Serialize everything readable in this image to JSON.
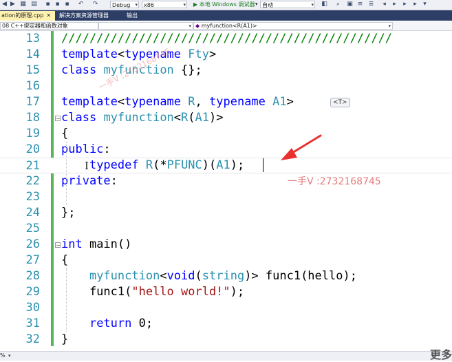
{
  "toolbar": {
    "config": "Debug",
    "platform": "x86",
    "run_label": "▶ 本地 Windows 调试器",
    "run_mode": "自动"
  },
  "tabs": [
    {
      "label": "ation的原理.cpp",
      "active": true
    },
    {
      "label": "解决方案资源管理器",
      "active": false
    },
    {
      "label": "输出",
      "active": false
    }
  ],
  "nav": {
    "project": "08 C++绑定器和函数对象",
    "scope": "",
    "member": "myfunction<R(A1)>"
  },
  "editor": {
    "lines": [
      {
        "num": "13",
        "code": "///////////////////////////////////////////////"
      },
      {
        "num": "14",
        "code": "template<typename Fty>"
      },
      {
        "num": "15",
        "code": "class myfunction {};"
      },
      {
        "num": "16",
        "code": ""
      },
      {
        "num": "17",
        "code": "template<typename R, typename A1>"
      },
      {
        "num": "18",
        "code": "class myfunction<R(A1)>"
      },
      {
        "num": "19",
        "code": "{"
      },
      {
        "num": "20",
        "code": "public:"
      },
      {
        "num": "21",
        "code": "    typedef R(*PFUNC)(A1);"
      },
      {
        "num": "22",
        "code": "private:"
      },
      {
        "num": "23",
        "code": ""
      },
      {
        "num": "24",
        "code": "};"
      },
      {
        "num": "25",
        "code": ""
      },
      {
        "num": "26",
        "code": "int main()"
      },
      {
        "num": "27",
        "code": "{"
      },
      {
        "num": "28",
        "code": "    myfunction<void(string)> func1(hello);"
      },
      {
        "num": "29",
        "code": "    func1(\"hello world!\");"
      },
      {
        "num": "30",
        "code": ""
      },
      {
        "num": "31",
        "code": "    return 0;"
      },
      {
        "num": "32",
        "code": "}"
      }
    ],
    "template_badge": "<T>"
  },
  "annotation": {
    "watermark_text": "一手V :2732168745",
    "faint_watermark": "一手V :2732168745",
    "arrow_color": "#e8312f"
  },
  "status": {
    "zoom": "%",
    "more_label": "更多"
  }
}
